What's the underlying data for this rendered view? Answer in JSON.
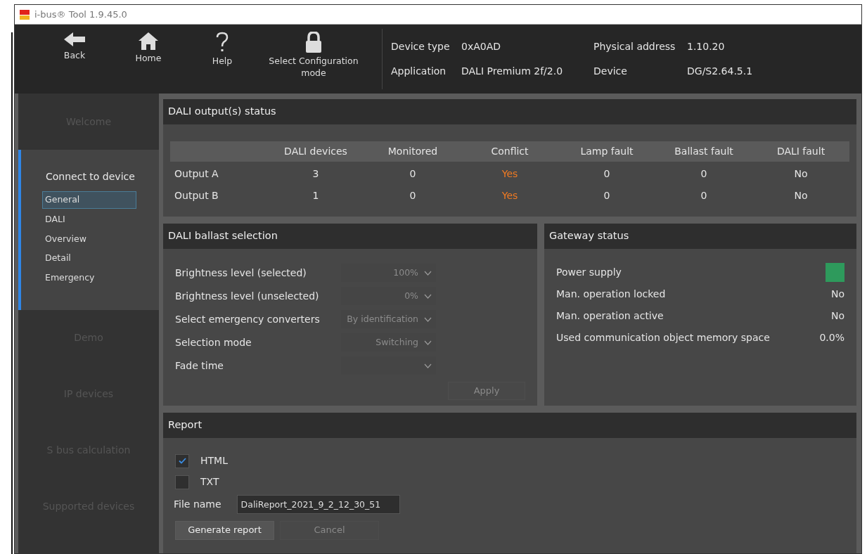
{
  "window": {
    "title": "i-bus® Tool 1.9.45.0"
  },
  "toolbar": {
    "buttons": [
      {
        "label": "Back"
      },
      {
        "label": "Home"
      },
      {
        "label": "Help"
      },
      {
        "label": "Select Configuration mode"
      }
    ],
    "device_info": [
      {
        "label": "Device type",
        "value": "0xA0AD"
      },
      {
        "label": "Physical address",
        "value": "1.10.20"
      },
      {
        "label": "Application",
        "value": "DALI Premium 2f/2.0"
      },
      {
        "label": "Device",
        "value": "DG/S2.64.5.1"
      }
    ]
  },
  "sidebar": {
    "sections": [
      {
        "label": "Welcome",
        "expanded": false
      },
      {
        "label": "Connect to device",
        "expanded": true,
        "children": [
          {
            "label": "General",
            "selected": true
          },
          {
            "label": "DALI",
            "selected": false
          },
          {
            "label": "Overview",
            "selected": false
          },
          {
            "label": "Detail",
            "selected": false
          },
          {
            "label": "Emergency",
            "selected": false
          }
        ]
      },
      {
        "label": "Demo",
        "expanded": false
      },
      {
        "label": "IP devices",
        "expanded": false
      },
      {
        "label": "S bus calculation",
        "expanded": false
      },
      {
        "label": "Supported devices",
        "expanded": false
      }
    ]
  },
  "outputs_status": {
    "title": "DALI output(s) status",
    "columns": [
      "DALI devices",
      "Monitored",
      "Conflict",
      "Lamp fault",
      "Ballast fault",
      "DALI fault"
    ],
    "rows": [
      {
        "name": "Output A",
        "cells": [
          "3",
          "0",
          "Yes",
          "0",
          "0",
          "No"
        ],
        "conflict": true
      },
      {
        "name": "Output B",
        "cells": [
          "1",
          "0",
          "Yes",
          "0",
          "0",
          "No"
        ],
        "conflict": true
      }
    ]
  },
  "ballast_selection": {
    "title": "DALI ballast selection",
    "fields": [
      {
        "label": "Brightness level (selected)",
        "value": "100%",
        "disabled": true
      },
      {
        "label": "Brightness level (unselected)",
        "value": "0%",
        "disabled": true
      },
      {
        "label": "Select emergency converters",
        "value": "By identification",
        "disabled": true
      },
      {
        "label": "Selection mode",
        "value": "Switching",
        "disabled": true
      },
      {
        "label": "Fade time",
        "disabled": true
      }
    ],
    "apply": {
      "label": "Apply",
      "disabled": true
    }
  },
  "gateway_status": {
    "title": "Gateway status",
    "items": [
      {
        "label": "Power supply",
        "kind": "indicator",
        "color": "#2e9a5c"
      },
      {
        "label": "Man. operation locked",
        "kind": "text",
        "value": "No"
      },
      {
        "label": "Man. operation active",
        "kind": "text",
        "value": "No"
      },
      {
        "label": "Used communication object memory space",
        "kind": "text",
        "value": "0.0%"
      }
    ]
  },
  "report": {
    "title": "Report",
    "formats": [
      {
        "label": "HTML",
        "checked": true
      },
      {
        "label": "TXT",
        "checked": false
      }
    ],
    "file_name": {
      "label": "File name",
      "value": "DaliReport_2021_9_2_12_30_51"
    },
    "buttons": [
      {
        "label": "Generate report",
        "disabled": false
      },
      {
        "label": "Cancel",
        "disabled": true
      }
    ]
  }
}
